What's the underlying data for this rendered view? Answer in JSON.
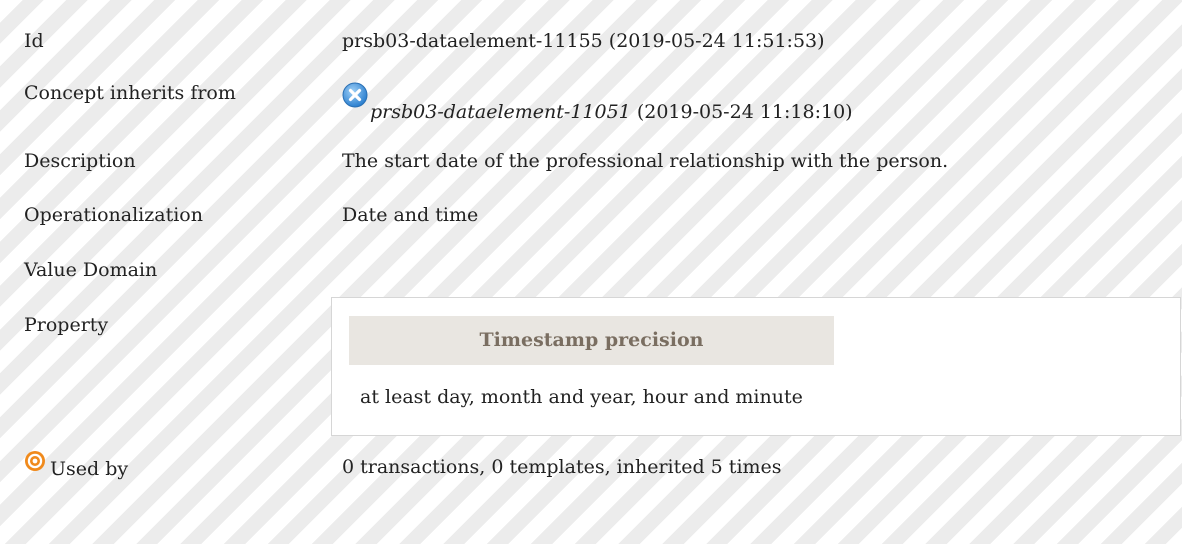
{
  "rows": {
    "id": {
      "label": "Id",
      "value": "prsb03-dataelement-11155 (2019-05-24 11:51:53)"
    },
    "inherits": {
      "label": "Concept inherits from",
      "link": "prsb03-dataelement-11051",
      "suffix": " (2019-05-24 11:18:10)",
      "icon": "close-circle-icon"
    },
    "description": {
      "label": "Description",
      "value": "The start date of the professional relationship with the person."
    },
    "operationalization": {
      "label": "Operationalization",
      "value": "Date and time"
    },
    "value_domain": {
      "label": "Value Domain"
    },
    "property": {
      "label": "Property",
      "header": "Timestamp precision",
      "value": "at least day, month and year, hour and minute"
    },
    "used_by": {
      "label": "Used by",
      "icon": "target-icon",
      "value": "0 transactions, 0 templates, inherited 5 times"
    }
  },
  "colors": {
    "text": "#222222",
    "icon_blue": "#4a9fe0",
    "icon_orange": "#f08a1c",
    "header_bg": "#e9e6e1",
    "header_text": "#7a6e61"
  }
}
